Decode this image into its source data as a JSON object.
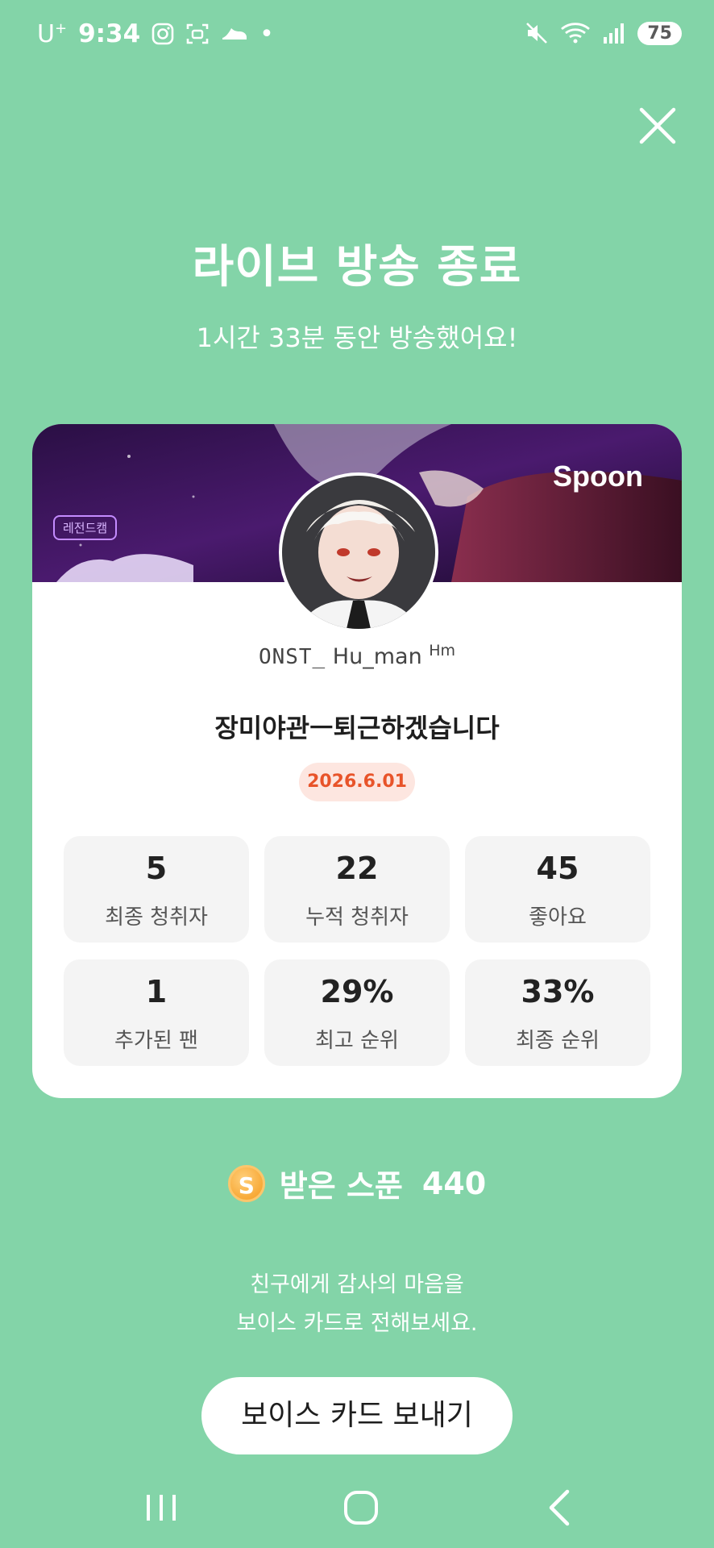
{
  "status_bar": {
    "carrier": "U",
    "carrier_sup": "+",
    "time": "9:34",
    "battery": "75"
  },
  "header": {
    "title": "라이브 방송 종료",
    "subtitle": "1시간 33분 동안 방송했어요!"
  },
  "card": {
    "banner_tag": "레전드캠",
    "brand": "Spoon",
    "username_prefix": "ONST_",
    "username_main": " Hu_man ",
    "username_sup": "Hm",
    "broadcast_title": "장미야관ㅡ퇴근하겠습니다",
    "date": "2026.6.01",
    "stats": [
      {
        "value": "5",
        "label": "최종 청취자"
      },
      {
        "value": "22",
        "label": "누적 청취자"
      },
      {
        "value": "45",
        "label": "좋아요"
      },
      {
        "value": "1",
        "label": "추가된 팬"
      },
      {
        "value": "29%",
        "label": "최고 순위"
      },
      {
        "value": "33%",
        "label": "최종 순위"
      }
    ]
  },
  "received": {
    "coin_letter": "S",
    "label": "받은 스푼",
    "amount": "440"
  },
  "thanks": {
    "line1": "친구에게 감사의 마음을",
    "line2": "보이스 카드로 전해보세요."
  },
  "voice_button": "보이스 카드 보내기",
  "colors": {
    "background": "#83d4a8",
    "date_text": "#e8542a",
    "date_bg": "#fde6e0"
  }
}
